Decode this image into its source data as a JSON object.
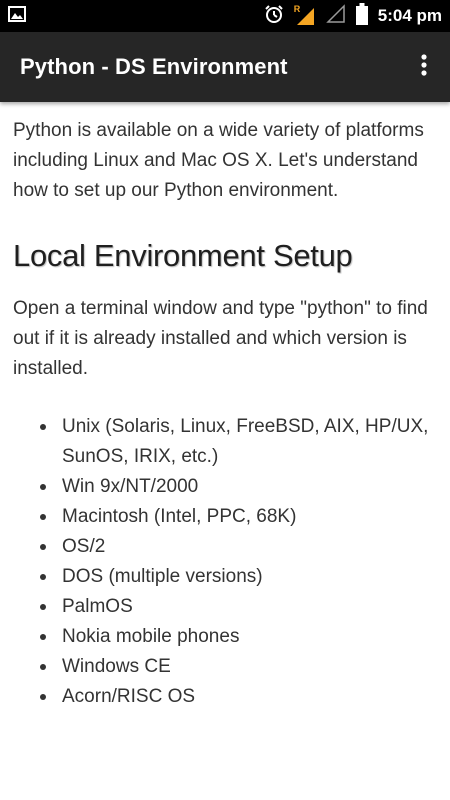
{
  "status_bar": {
    "time": "5:04 pm",
    "icons": [
      "image-icon",
      "alarm-icon",
      "signal-r-icon",
      "signal-empty-icon",
      "battery-icon"
    ],
    "roaming_label": "R",
    "signal_accent": "#f5a623"
  },
  "app_bar": {
    "title": "Python - DS Environment",
    "menu_icon": "more-vert-icon",
    "background": "#262626"
  },
  "content": {
    "intro": "Python is available on a wide variety of platforms including Linux and Mac OS X. Let's understand how to set up our Python environment.",
    "heading": "Local Environment Setup",
    "paragraph": "Open a terminal window and type \"python\" to find out if it is already installed and which version is installed.",
    "list": [
      "Unix (Solaris, Linux, FreeBSD, AIX, HP/UX, SunOS, IRIX, etc.)",
      "Win 9x/NT/2000",
      "Macintosh (Intel, PPC, 68K)",
      "OS/2",
      "DOS (multiple versions)",
      "PalmOS",
      "Nokia mobile phones",
      "Windows CE",
      "Acorn/RISC OS"
    ]
  }
}
